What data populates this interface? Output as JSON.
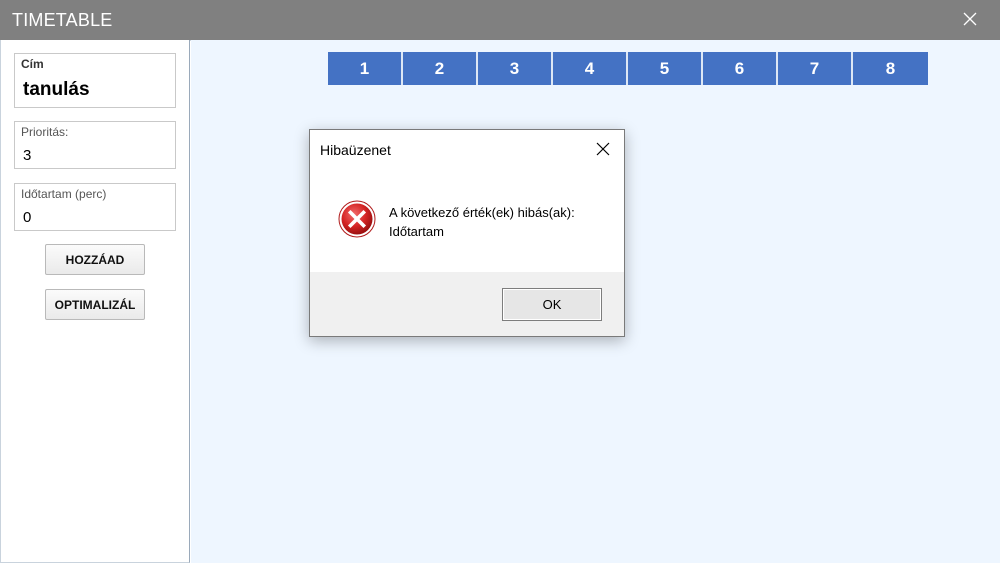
{
  "window": {
    "title": "TIMETABLE"
  },
  "sidebar": {
    "title_field": {
      "label": "Cím",
      "value": "tanulás"
    },
    "priority_field": {
      "label": "Prioritás:",
      "value": "3"
    },
    "duration_field": {
      "label": "Időtartam (perc)",
      "value": "0"
    },
    "add_button": "HOZZÁAD",
    "optimize_button": "OPTIMALIZÁL"
  },
  "timetable": {
    "slots": [
      "1",
      "2",
      "3",
      "4",
      "5",
      "6",
      "7",
      "8"
    ],
    "slot_color": "#4472c4",
    "background": "#eef6ff"
  },
  "dialog": {
    "title": "Hibaüzenet",
    "message_line1": "A következő érték(ek) hibás(ak):",
    "message_line2": "Időtartam",
    "ok_button": "OK",
    "icon": "error-icon"
  }
}
